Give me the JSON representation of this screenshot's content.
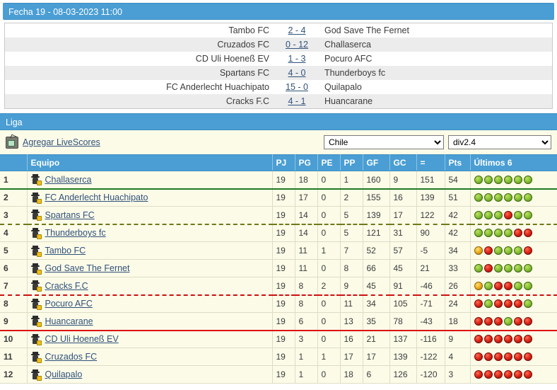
{
  "fecha": {
    "title": "Fecha 19 - 08-03-2023 11:00"
  },
  "matches": [
    {
      "home": "Tambo FC",
      "score": "2 - 4",
      "away": "God Save The Fernet"
    },
    {
      "home": "Cruzados FC",
      "score": "0 - 12",
      "away": "Challaserca"
    },
    {
      "home": "CD Uli Hoeneß EV",
      "score": "1 - 3",
      "away": "Pocuro AFC"
    },
    {
      "home": "Spartans FC",
      "score": "4 - 0",
      "away": "Thunderboys fc"
    },
    {
      "home": "FC Anderlecht Huachipato",
      "score": "15 - 0",
      "away": "Quilapalo"
    },
    {
      "home": "Cracks F.C",
      "score": "4 - 1",
      "away": "Huancarane"
    }
  ],
  "liga": {
    "title": "Liga"
  },
  "controls": {
    "livescores_label": "Agregar LiveScores",
    "tv_icon": "tv-icon",
    "country_selected": "Chile",
    "country_options": [
      "Chile"
    ],
    "division_selected": "div2.4",
    "division_options": [
      "div2.4"
    ]
  },
  "standings": {
    "headers": {
      "pos": "",
      "team": "Equipo",
      "pj": "PJ",
      "pg": "PG",
      "pe": "PE",
      "pp": "PP",
      "gf": "GF",
      "gc": "GC",
      "dif": "=",
      "pts": "Pts",
      "form": "Últimos 6"
    },
    "rows": [
      {
        "pos": "1",
        "team": "Challaserca",
        "pj": "19",
        "pg": "18",
        "pe": "0",
        "pp": "1",
        "gf": "160",
        "gc": "9",
        "dif": "151",
        "pts": "54",
        "form": [
          "W",
          "W",
          "W",
          "W",
          "W",
          "W"
        ],
        "sep": "sep-green"
      },
      {
        "pos": "2",
        "team": "FC Anderlecht Huachipato",
        "pj": "19",
        "pg": "17",
        "pe": "0",
        "pp": "2",
        "gf": "155",
        "gc": "16",
        "dif": "139",
        "pts": "51",
        "form": [
          "W",
          "W",
          "W",
          "W",
          "W",
          "W"
        ],
        "sep": ""
      },
      {
        "pos": "3",
        "team": "Spartans FC",
        "pj": "19",
        "pg": "14",
        "pe": "0",
        "pp": "5",
        "gf": "139",
        "gc": "17",
        "dif": "122",
        "pts": "42",
        "form": [
          "W",
          "W",
          "W",
          "L",
          "W",
          "W"
        ],
        "sep": "sep-dash-olive"
      },
      {
        "pos": "4",
        "team": "Thunderboys fc",
        "pj": "19",
        "pg": "14",
        "pe": "0",
        "pp": "5",
        "gf": "121",
        "gc": "31",
        "dif": "90",
        "pts": "42",
        "form": [
          "W",
          "W",
          "W",
          "W",
          "L",
          "L"
        ],
        "sep": ""
      },
      {
        "pos": "5",
        "team": "Tambo FC",
        "pj": "19",
        "pg": "11",
        "pe": "1",
        "pp": "7",
        "gf": "52",
        "gc": "57",
        "dif": "-5",
        "pts": "34",
        "form": [
          "D",
          "L",
          "W",
          "W",
          "W",
          "L"
        ],
        "sep": ""
      },
      {
        "pos": "6",
        "team": "God Save The Fernet",
        "pj": "19",
        "pg": "11",
        "pe": "0",
        "pp": "8",
        "gf": "66",
        "gc": "45",
        "dif": "21",
        "pts": "33",
        "form": [
          "W",
          "L",
          "W",
          "W",
          "W",
          "W"
        ],
        "sep": ""
      },
      {
        "pos": "7",
        "team": "Cracks F.C",
        "pj": "19",
        "pg": "8",
        "pe": "2",
        "pp": "9",
        "gf": "45",
        "gc": "91",
        "dif": "-46",
        "pts": "26",
        "form": [
          "D",
          "W",
          "L",
          "L",
          "W",
          "W"
        ],
        "sep": "sep-dash-red"
      },
      {
        "pos": "8",
        "team": "Pocuro AFC",
        "pj": "19",
        "pg": "8",
        "pe": "0",
        "pp": "11",
        "gf": "34",
        "gc": "105",
        "dif": "-71",
        "pts": "24",
        "form": [
          "L",
          "W",
          "L",
          "L",
          "L",
          "W"
        ],
        "sep": ""
      },
      {
        "pos": "9",
        "team": "Huancarane",
        "pj": "19",
        "pg": "6",
        "pe": "0",
        "pp": "13",
        "gf": "35",
        "gc": "78",
        "dif": "-43",
        "pts": "18",
        "form": [
          "L",
          "L",
          "L",
          "W",
          "L",
          "L"
        ],
        "sep": "sep-red"
      },
      {
        "pos": "10",
        "team": "CD Uli Hoeneß EV",
        "pj": "19",
        "pg": "3",
        "pe": "0",
        "pp": "16",
        "gf": "21",
        "gc": "137",
        "dif": "-116",
        "pts": "9",
        "form": [
          "L",
          "L",
          "L",
          "L",
          "L",
          "L"
        ],
        "sep": ""
      },
      {
        "pos": "11",
        "team": "Cruzados FC",
        "pj": "19",
        "pg": "1",
        "pe": "1",
        "pp": "17",
        "gf": "17",
        "gc": "139",
        "dif": "-122",
        "pts": "4",
        "form": [
          "L",
          "L",
          "L",
          "L",
          "L",
          "L"
        ],
        "sep": ""
      },
      {
        "pos": "12",
        "team": "Quilapalo",
        "pj": "19",
        "pg": "1",
        "pe": "0",
        "pp": "18",
        "gf": "6",
        "gc": "126",
        "dif": "-120",
        "pts": "3",
        "form": [
          "L",
          "L",
          "L",
          "L",
          "L",
          "L"
        ],
        "sep": ""
      }
    ]
  },
  "colors": {
    "header_blue": "#4a9ed4",
    "table_bg": "#fbfbe8",
    "link": "#31517a",
    "win": "#8cc43a",
    "loss": "#e22a1c",
    "draw": "#f0b420",
    "sep_promotion": "#1f7a1f",
    "sep_playoff": "#6e7a18",
    "sep_relegation": "#dd1111"
  }
}
